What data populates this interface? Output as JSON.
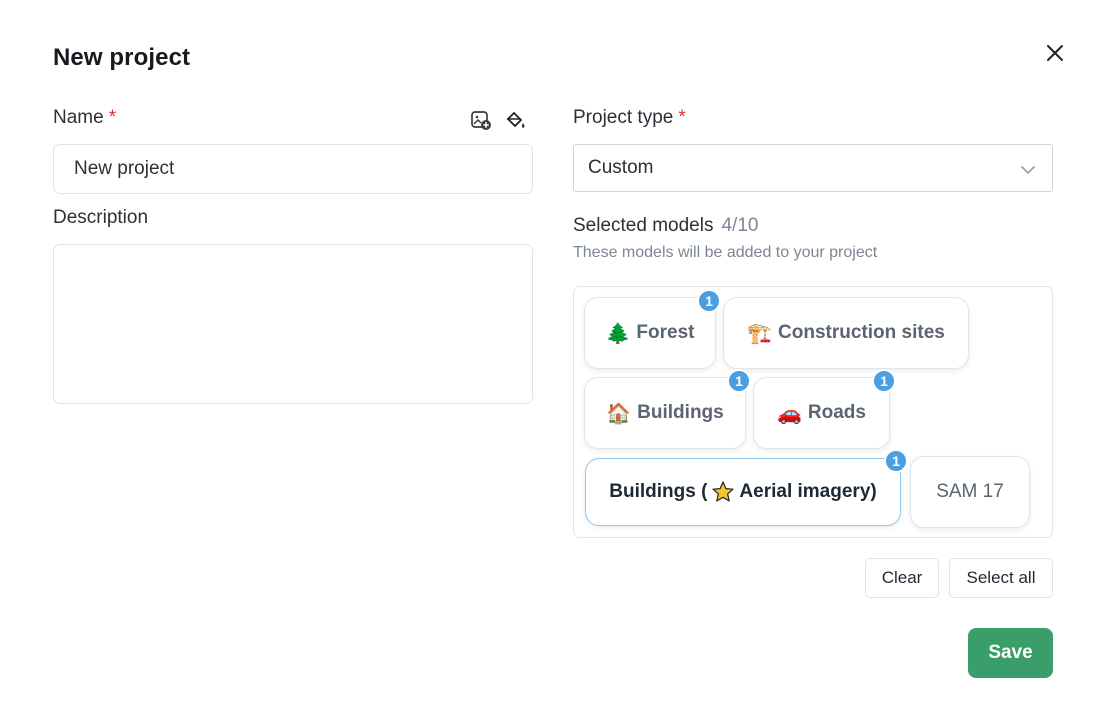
{
  "dialog": {
    "title": "New project",
    "close_icon": "close-icon"
  },
  "form": {
    "name": {
      "label": "Name",
      "required_mark": "*",
      "value": "New project",
      "tools": [
        "image-add-icon",
        "paint-bucket-icon"
      ]
    },
    "description": {
      "label": "Description",
      "value": ""
    },
    "project_type": {
      "label": "Project type",
      "required_mark": "*",
      "selected": "Custom"
    },
    "models": {
      "label": "Selected models",
      "count": "4/10",
      "subtitle": "These models will be added to your project",
      "items": [
        {
          "emoji": "🌲",
          "label": "Forest",
          "badge": "1",
          "selected": false
        },
        {
          "emoji": "🏗️",
          "label": "Construction sites",
          "badge": "",
          "selected": false
        },
        {
          "emoji": "🏠",
          "label": "Buildings",
          "badge": "1",
          "selected": false
        },
        {
          "emoji": "🚗",
          "label": "Roads",
          "badge": "1",
          "selected": false
        },
        {
          "label_before": "Buildings (",
          "label_after": "Aerial imagery)",
          "badge": "1",
          "selected": true
        },
        {
          "label": "SAM 17",
          "badge": "",
          "selected": false
        }
      ]
    }
  },
  "actions": {
    "clear": "Clear",
    "select_all": "Select all",
    "save": "Save"
  },
  "colors": {
    "accent": "#4b9fe1",
    "save": "#3a9e6a",
    "required": "#e03131",
    "selected_border": "#8fc6ec"
  }
}
